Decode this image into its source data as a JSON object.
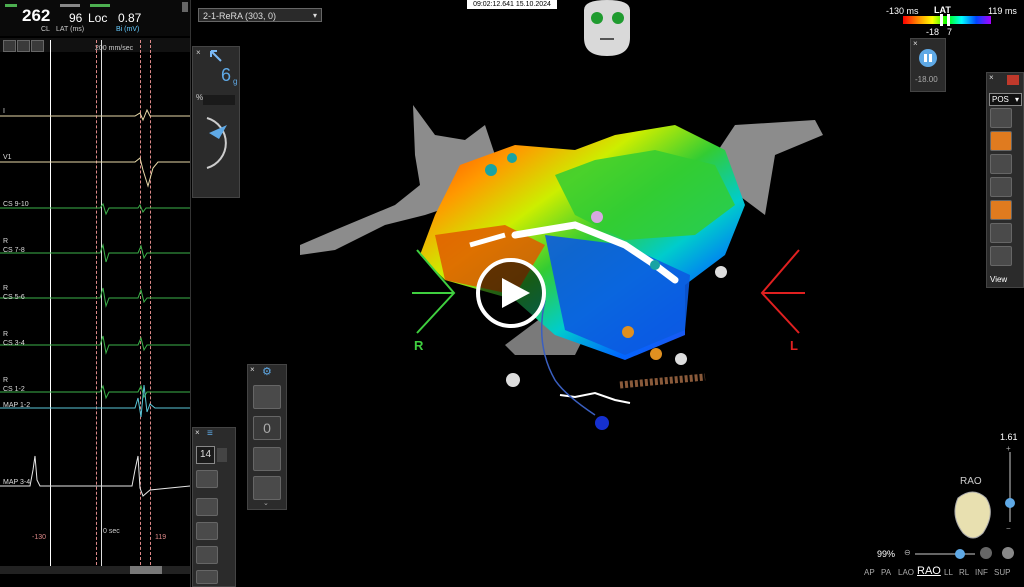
{
  "ecg": {
    "cl_value": "262",
    "cl_label": "CL",
    "lat_value": "96",
    "loc_label": "Loc",
    "lat_label": "LAT (ms)",
    "bi_value": "0.87",
    "bi_label": "Bi (mV)",
    "speed_label": "200 mm/sec",
    "leads": [
      {
        "name": "I"
      },
      {
        "name": "V1"
      },
      {
        "name": "CS 9-10"
      },
      {
        "name": "CS 7-8"
      },
      {
        "name": "CS 5-6"
      },
      {
        "name": "CS 3-4"
      },
      {
        "name": "CS 1-2"
      },
      {
        "name": "MAP 1-2"
      },
      {
        "name": "MAP 3-4"
      }
    ],
    "time_left": "-130",
    "time_zero": "0 sec",
    "time_right": "119"
  },
  "map": {
    "selector": "2-1-ReRA (303, 0)",
    "timestamp": "09:02:12.641 15.10.2024",
    "left_marker": "R",
    "right_marker": "L"
  },
  "lat_scale": {
    "min": "-130 ms",
    "title": "LAT",
    "max": "119 ms",
    "v1": "-18",
    "v2": "7",
    "colors": [
      "#ff0000",
      "#ff8800",
      "#ffff00",
      "#00ff00",
      "#00ffff",
      "#0044ff",
      "#aa00ff"
    ]
  },
  "force_panel": {
    "value": "6",
    "unit": "g"
  },
  "pause_panel": {
    "value": "-18.00"
  },
  "right_toolbar": {
    "pos_label": "POS",
    "view_label": "View"
  },
  "mid_panel": {
    "counter": "0"
  },
  "lower_panel": {
    "counter": "14"
  },
  "view": {
    "zoom": "99%",
    "scale": "1.61",
    "orientation": "RAO",
    "buttons": [
      "AP",
      "PA",
      "LAO",
      "RAO",
      "LL",
      "RL",
      "INF",
      "SUP"
    ]
  }
}
